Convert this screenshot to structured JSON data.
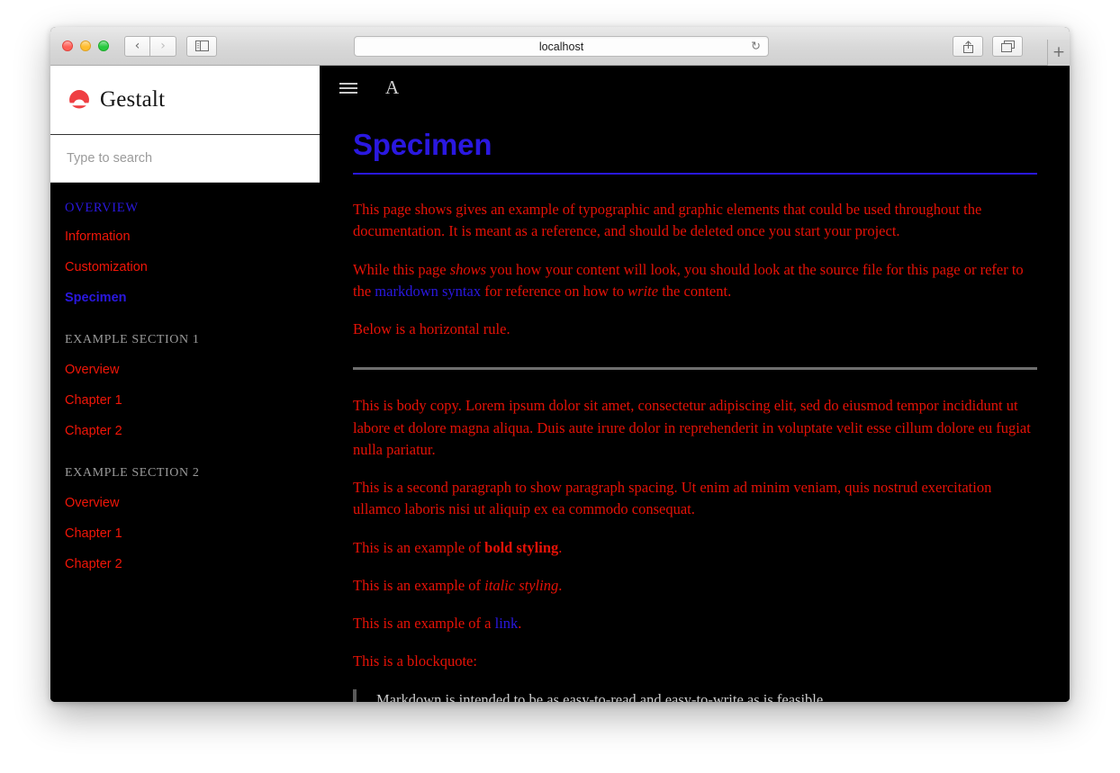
{
  "browser": {
    "url": "localhost",
    "back_icon": "chevron-left-icon",
    "forward_icon": "chevron-right-icon",
    "sidebar_toggle_icon": "sidebar-icon",
    "reload_icon": "reload-icon",
    "share_icon": "share-icon",
    "tabs_icon": "tabs-icon",
    "newtab_label": "+"
  },
  "sidebar": {
    "brand": "Gestalt",
    "logo_icon": "gestalt-logo-icon",
    "logo_color": "#ef3e42",
    "search": {
      "placeholder": "Type to search",
      "value": ""
    },
    "overview_label": "OVERVIEW",
    "overview_items": [
      {
        "label": "Information",
        "active": false
      },
      {
        "label": "Customization",
        "active": false
      },
      {
        "label": "Specimen",
        "active": true
      }
    ],
    "sections": [
      {
        "title": "EXAMPLE SECTION 1",
        "items": [
          {
            "label": "Overview"
          },
          {
            "label": "Chapter 1"
          },
          {
            "label": "Chapter 2"
          }
        ]
      },
      {
        "title": "EXAMPLE SECTION 2",
        "items": [
          {
            "label": "Overview"
          },
          {
            "label": "Chapter 1"
          },
          {
            "label": "Chapter 2"
          }
        ]
      }
    ]
  },
  "docbar": {
    "menu_icon": "hamburger-menu-icon",
    "typography_icon": "typography-a-icon",
    "typography_label": "A"
  },
  "page": {
    "title": "Specimen",
    "p1": "This page shows gives an example of typographic and graphic elements that could be used throughout the documentation. It is meant as a reference, and should be deleted once you start your project.",
    "p2_a": "While this page ",
    "p2_em": "shows",
    "p2_b": " you how your content will look, you should look at the source file for this page or refer to the ",
    "p2_link": "markdown syntax",
    "p2_c": " for reference on how to ",
    "p2_em2": "write",
    "p2_d": " the content.",
    "p3": "Below is a horizontal rule.",
    "p4": "This is body copy. Lorem ipsum dolor sit amet, consectetur adipiscing elit, sed do eiusmod tempor incididunt ut labore et dolore magna aliqua. Duis aute irure dolor in reprehenderit in voluptate velit esse cillum dolore eu fugiat nulla pariatur.",
    "p5": "This is a second paragraph to show paragraph spacing. Ut enim ad minim veniam, quis nostrud exercitation ullamco laboris nisi ut aliquip ex ea commodo consequat.",
    "bold_a": "This is an example of ",
    "bold_b": "bold styling",
    "bold_c": ".",
    "italic_a": "This is an example of ",
    "italic_b": "italic styling",
    "italic_c": ".",
    "link_a": "This is an example of a ",
    "link_b": "link",
    "link_c": ".",
    "blockquote_intro": "This is a blockquote:",
    "blockquote_text": "Markdown is intended to be as easy-to-read and easy-to-write as is feasible."
  },
  "colors": {
    "body_text": "#e61207",
    "link": "#2a18e0",
    "heading": "#2a18e0",
    "section_label": "#9a9a9a",
    "background": "#000000",
    "rule": "#6e6e6e",
    "quote_text": "#cccccc"
  }
}
